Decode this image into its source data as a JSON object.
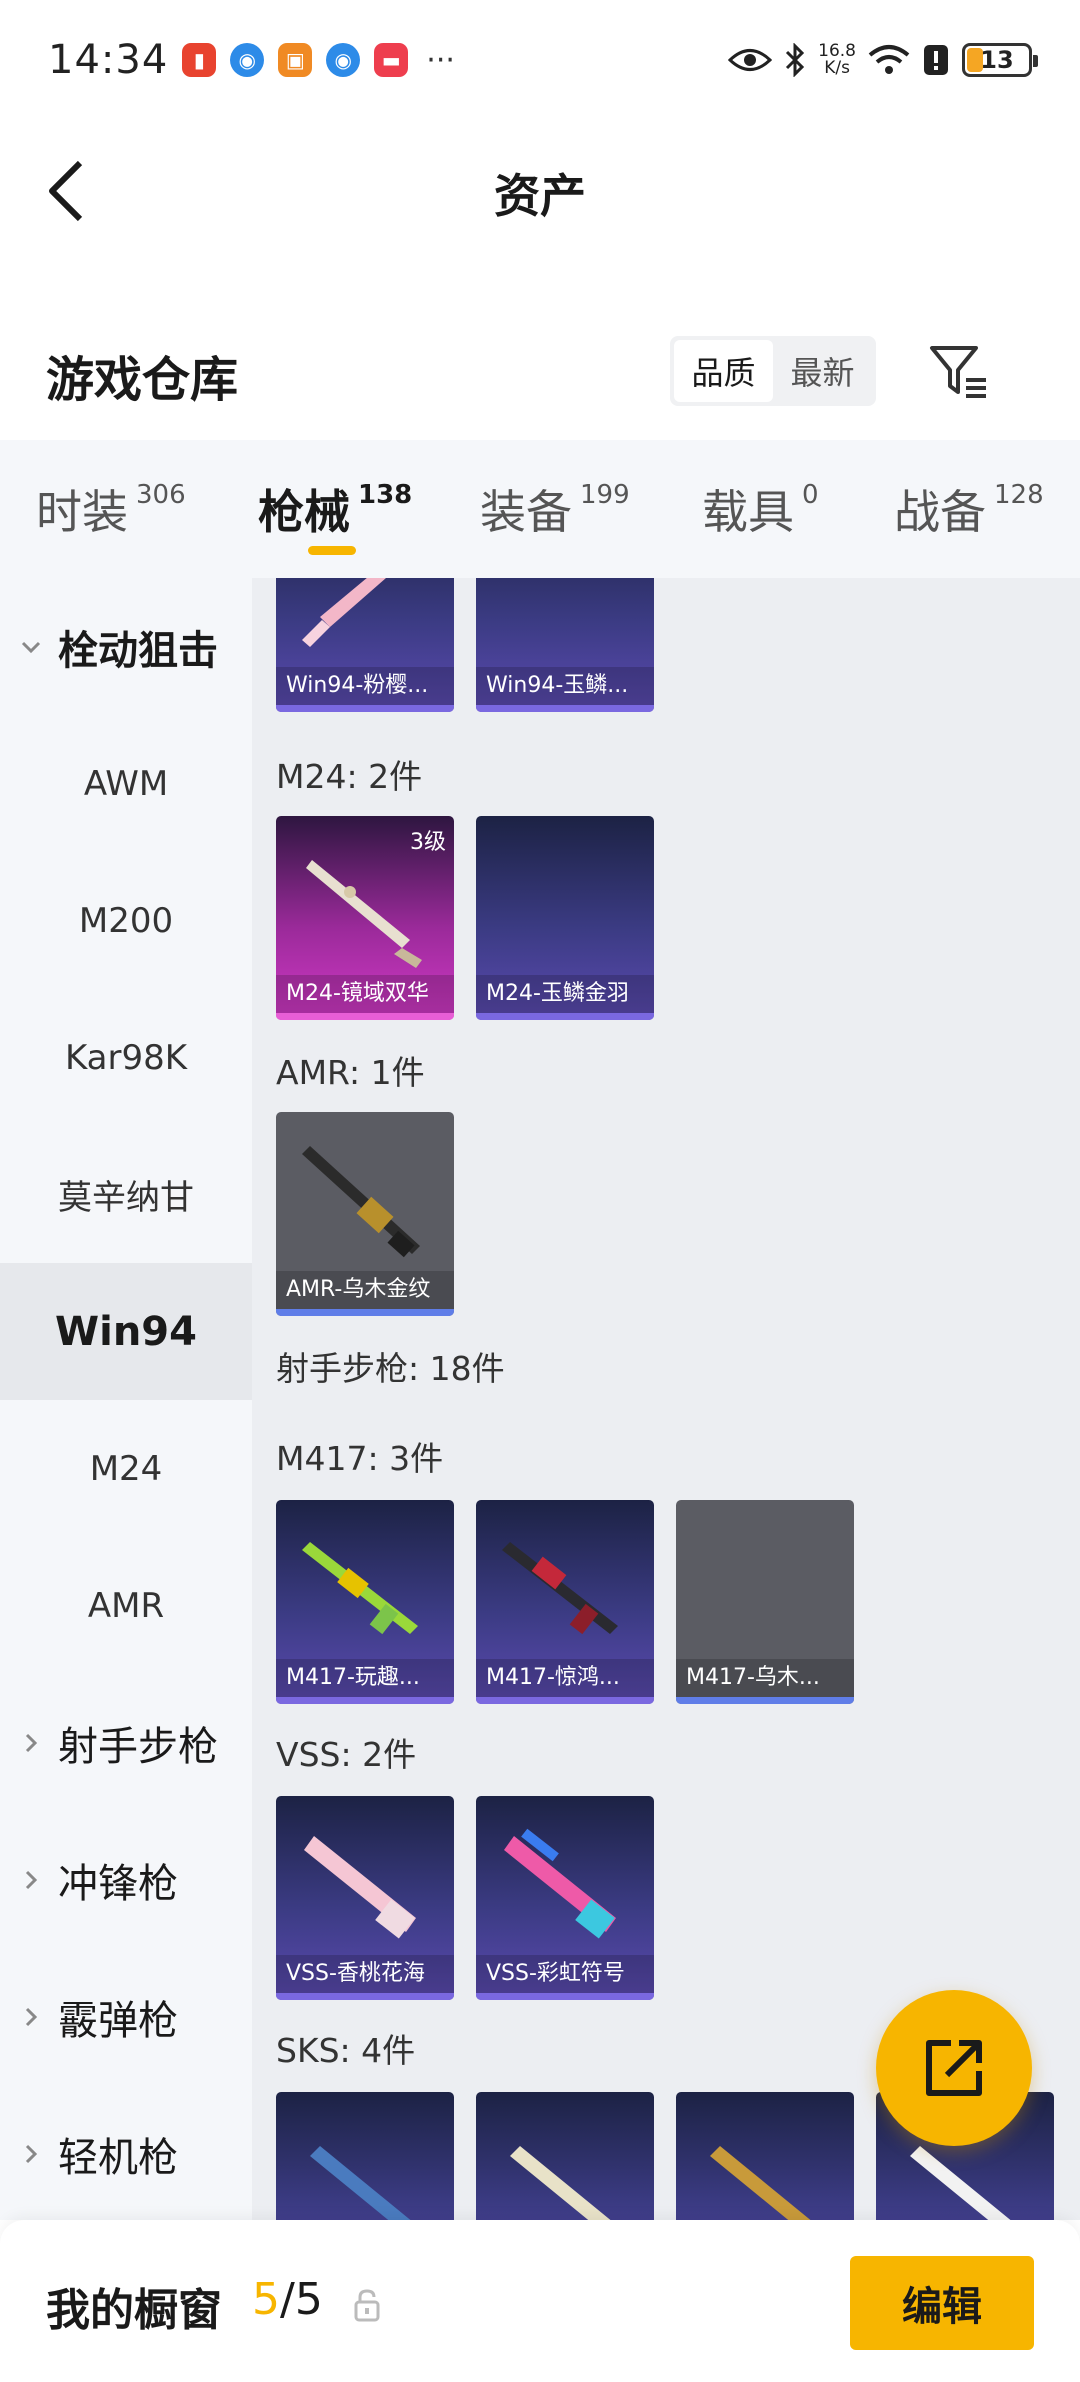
{
  "status_bar": {
    "time": "14:34",
    "more": "···",
    "net_speed_value": "16.8",
    "net_speed_unit": "K/s",
    "battery": "13",
    "app_icons": [
      "red-app-icon",
      "blue-app-icon",
      "orange-game-icon",
      "blue-app-icon-2",
      "red-shop-icon"
    ]
  },
  "nav": {
    "title": "资产"
  },
  "warehouse": {
    "title": "游戏仓库",
    "sort_options": [
      "品质",
      "最新"
    ],
    "active_sort": "品质"
  },
  "tabs": [
    {
      "label": "时装",
      "count": "306"
    },
    {
      "label": "枪械",
      "count": "138",
      "active": true
    },
    {
      "label": "装备",
      "count": "199"
    },
    {
      "label": "载具",
      "count": "0"
    },
    {
      "label": "战备",
      "count": "128"
    }
  ],
  "sidebar": {
    "group_expanded": "栓动狙击",
    "items": [
      "AWM",
      "M200",
      "Kar98K",
      "莫辛纳甘",
      "Win94",
      "M24",
      "AMR"
    ],
    "selected": "Win94",
    "groups_collapsed": [
      "射手步枪",
      "冲锋枪",
      "霰弹枪",
      "轻机枪"
    ]
  },
  "content": {
    "win94_items": [
      "Win94-粉樱...",
      "Win94-玉鳞..."
    ],
    "m24_title": "M24: 2件",
    "m24_items": [
      {
        "name": "M24-镜域双华",
        "tier": "3级"
      },
      {
        "name": "M24-玉鳞金羽"
      }
    ],
    "amr_title": "AMR: 1件",
    "amr_items": [
      "AMR-乌木金纹"
    ],
    "marksman_title": "射手步枪: 18件",
    "m417_title": "M417: 3件",
    "m417_items": [
      "M417-玩趣...",
      "M417-惊鸿...",
      "M417-乌木..."
    ],
    "vss_title": "VSS: 2件",
    "vss_items": [
      "VSS-香桃花海",
      "VSS-彩虹符号"
    ],
    "sks_title": "SKS: 4件"
  },
  "bottom": {
    "label": "我的橱窗",
    "count_current": "5",
    "count_sep": "/",
    "count_total": "5",
    "edit": "编辑"
  },
  "colors": {
    "accent": "#f7b500",
    "card_blue": "#3b3b83",
    "card_purple": "#d039c5",
    "card_grey": "#5b5c63"
  }
}
